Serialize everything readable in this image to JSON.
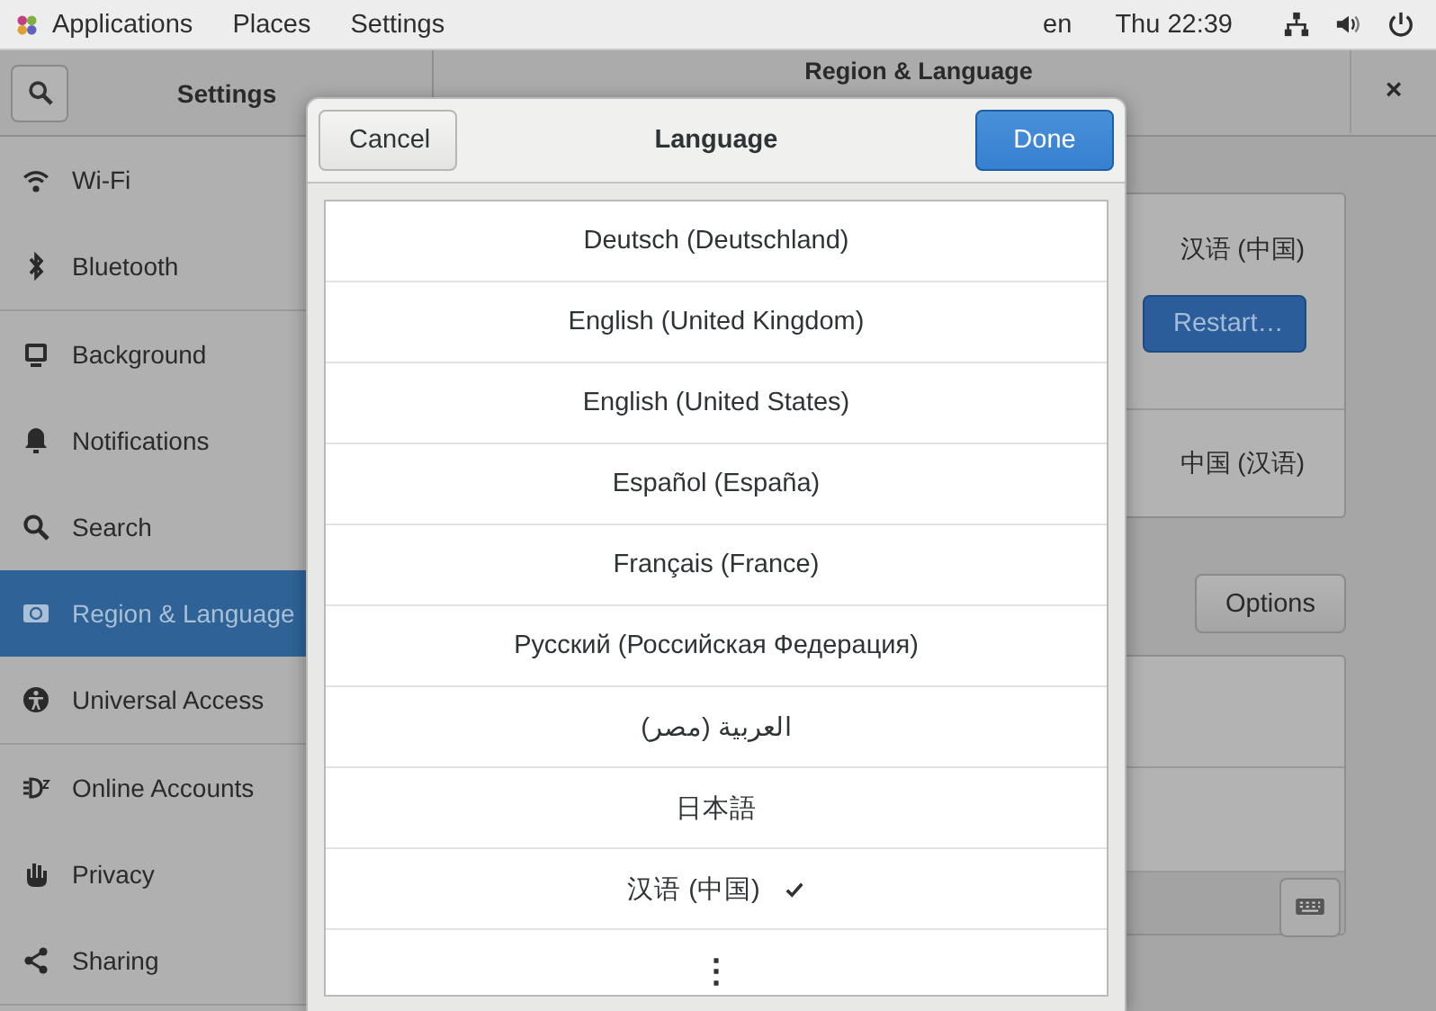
{
  "top_bar": {
    "menus": [
      "Applications",
      "Places",
      "Settings"
    ],
    "keyboard_layout": "en",
    "clock": "Thu 22:39"
  },
  "sidebar": {
    "title": "Settings",
    "groups": [
      [
        {
          "label": "Wi-Fi",
          "selected": false
        },
        {
          "label": "Bluetooth",
          "selected": false
        }
      ],
      [
        {
          "label": "Background",
          "selected": false
        },
        {
          "label": "Notifications",
          "selected": false
        },
        {
          "label": "Search",
          "selected": false
        },
        {
          "label": "Region & Language",
          "selected": true
        },
        {
          "label": "Universal Access",
          "selected": false
        }
      ],
      [
        {
          "label": "Online Accounts",
          "selected": false
        },
        {
          "label": "Privacy",
          "selected": false
        },
        {
          "label": "Sharing",
          "selected": false
        }
      ]
    ]
  },
  "region_pane": {
    "title": "Region & Language",
    "close": "×",
    "language_value": "汉语 (中国)",
    "restart_button": "Restart…",
    "formats_value": "中国 (汉语)",
    "options_button": "Options"
  },
  "language_dialog": {
    "title": "Language",
    "cancel_button": "Cancel",
    "done_button": "Done",
    "more": "⋮",
    "languages": [
      {
        "label": "Deutsch (Deutschland)",
        "selected": false
      },
      {
        "label": "English (United Kingdom)",
        "selected": false
      },
      {
        "label": "English (United States)",
        "selected": false
      },
      {
        "label": "Español (España)",
        "selected": false
      },
      {
        "label": "Français (France)",
        "selected": false
      },
      {
        "label": "Русский (Российская Федерация)",
        "selected": false
      },
      {
        "label": "العربية (مصر)",
        "selected": false
      },
      {
        "label": "日本語",
        "selected": false
      },
      {
        "label": "汉语 (中国)",
        "selected": true
      }
    ]
  }
}
